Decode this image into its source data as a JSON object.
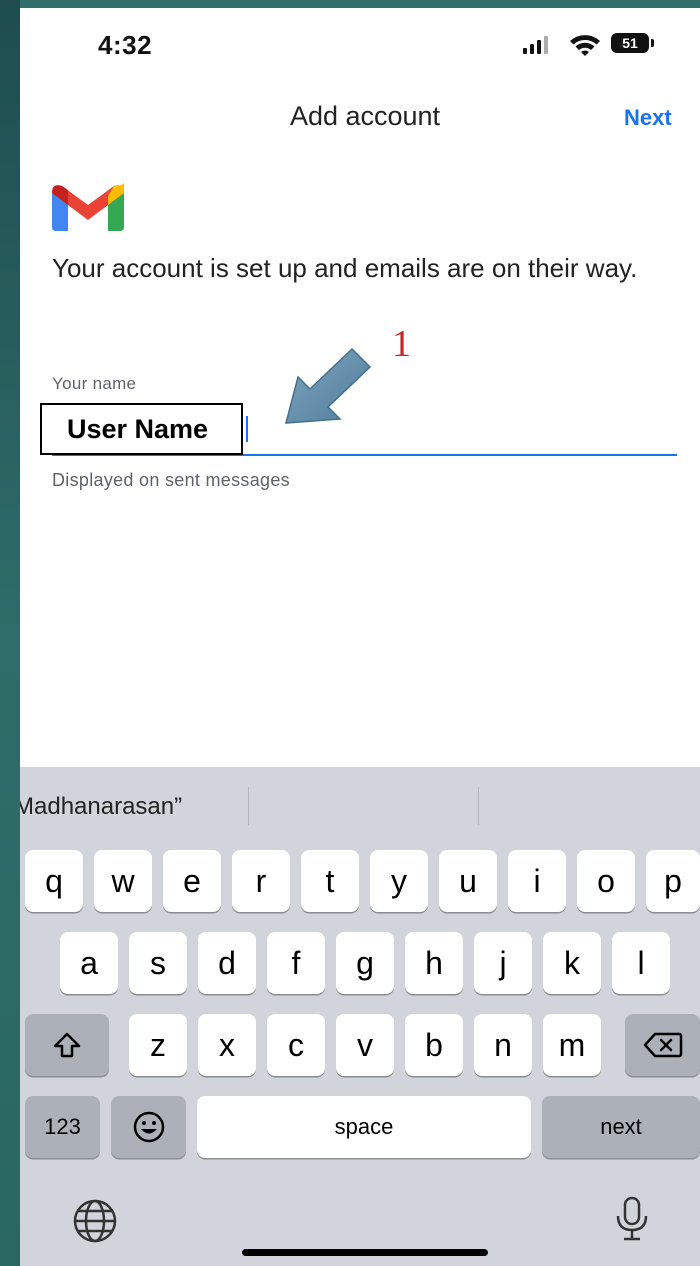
{
  "status_bar": {
    "time": "4:32",
    "battery": "51"
  },
  "nav": {
    "title": "Add account",
    "next_label": "Next"
  },
  "content": {
    "headline": "Your account is set up and emails are on their way.",
    "name_label": "Your name",
    "name_value": "User Name",
    "helper_text": "Displayed on sent messages"
  },
  "annotation": {
    "number": "1",
    "color": "#c0282a"
  },
  "keyboard": {
    "suggestions": [
      "Madhanarasan”"
    ],
    "row1": [
      "q",
      "w",
      "e",
      "r",
      "t",
      "y",
      "u",
      "i",
      "o",
      "p"
    ],
    "row2": [
      "a",
      "s",
      "d",
      "f",
      "g",
      "h",
      "j",
      "k",
      "l"
    ],
    "row3": [
      "z",
      "x",
      "c",
      "v",
      "b",
      "n",
      "m"
    ],
    "numbers_label": "123",
    "space_label": "space",
    "return_label": "next",
    "icons": [
      "shift-icon",
      "backspace-icon",
      "emoji-icon",
      "globe-icon",
      "microphone-icon"
    ]
  },
  "colors": {
    "accent": "#1a73e8",
    "keyboard_bg": "#d1d4da",
    "dark_key": "#abb0b9"
  }
}
